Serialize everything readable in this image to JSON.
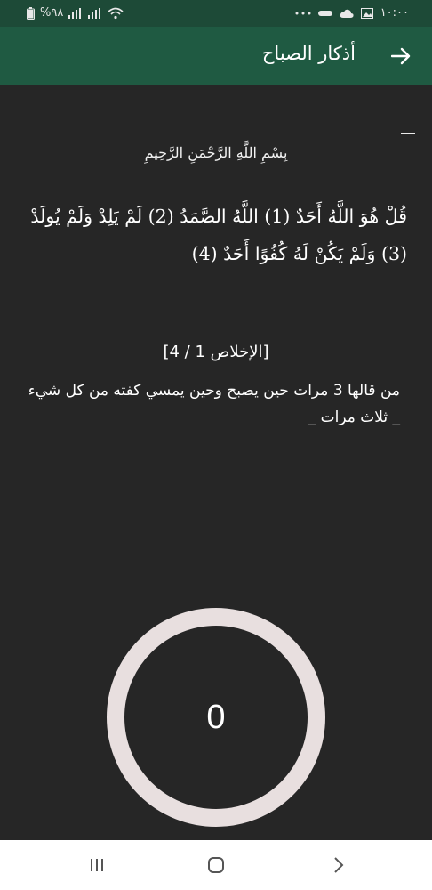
{
  "status_bar": {
    "time": "١٠:٠٠",
    "battery": "%٩٨",
    "icons": [
      "battery-icon",
      "signal-icon",
      "signal-icon",
      "wifi-icon",
      "gallery-icon",
      "cloud-icon",
      "notification-icon",
      "more-dots-icon"
    ]
  },
  "app_bar": {
    "title": "أذكار الصباح",
    "back_icon": "arrow-right-icon",
    "color": "#1f5a42"
  },
  "content": {
    "basmala": "بِسْمِ اللَّهِ الرَّحْمَنِ الرَّحِيمِ",
    "verse": "قُلْ هُوَ اللَّهُ أَحَدٌ (1) اللَّهُ الصَّمَدُ (2) لَمْ يَلِدْ وَلَمْ يُولَدْ (3) وَلَمْ يَكُنْ لَهُ كُفُوًا أَحَدٌ (4)",
    "reference": "[الإخلاص 1 / 4]",
    "benefit": "من قالها 3 مرات حين يصبح وحين يمسي كفته من كل شيء _ ثلاث مرات _"
  },
  "counter": {
    "value": "0",
    "ring_color": "#e8dfdf"
  },
  "nav_bar": {
    "icons": [
      "recent-apps-icon",
      "home-icon",
      "back-chevron-icon"
    ]
  }
}
